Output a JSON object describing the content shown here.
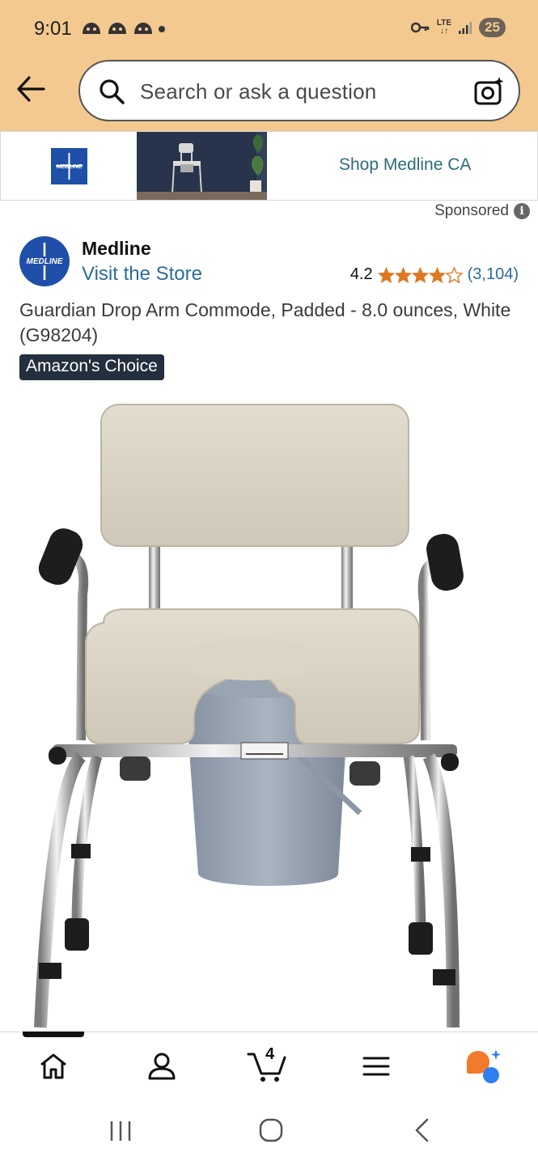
{
  "status_bar": {
    "time": "9:01",
    "network": "LTE",
    "battery": "25",
    "icons": [
      "notification-icon",
      "notification-icon",
      "notification-icon",
      "key-icon",
      "signal-icon"
    ]
  },
  "search": {
    "placeholder": "Search or ask a question",
    "icons": [
      "back-arrow-icon",
      "search-icon",
      "camera-sparkle-icon"
    ]
  },
  "banner": {
    "shop_label": "Shop Medline CA",
    "logo_text": "MEDLINE"
  },
  "sponsored_label": "Sponsored",
  "product": {
    "brand": "Medline",
    "brand_logo_text": "MEDLINE",
    "visit_store": "Visit the Store",
    "rating": "4.2",
    "stars": 4.2,
    "review_count": "(3,104)",
    "title": "Guardian Drop Arm Commode, Padded - 8.0 ounces, White (G98204)",
    "badge": "Amazon's Choice"
  },
  "bottom_nav": {
    "cart_count": "4",
    "items": [
      "home-icon",
      "account-icon",
      "cart-icon",
      "menu-icon",
      "rufus-assistant-icon"
    ]
  },
  "colors": {
    "header": "#f3c98f",
    "link": "#2b6c9a",
    "star": "#de7921",
    "badge": "#232f3e",
    "medline_blue": "#1f4fa8"
  }
}
